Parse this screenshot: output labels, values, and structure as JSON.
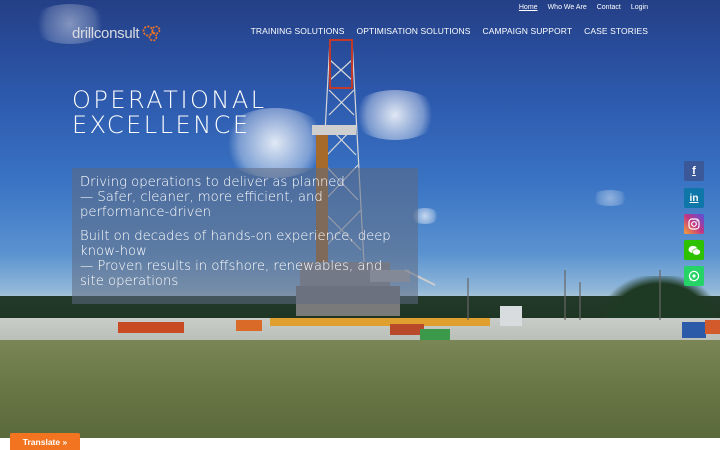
{
  "brand": {
    "logo_text": "drillconsult",
    "accent": "#f27420"
  },
  "top_nav": [
    {
      "label": "Home",
      "active": true
    },
    {
      "label": "Who We Are"
    },
    {
      "label": "Contact"
    },
    {
      "label": "Login"
    }
  ],
  "main_nav": [
    {
      "label": "TRAINING SOLUTIONS"
    },
    {
      "label": "OPTIMISATION SOLUTIONS"
    },
    {
      "label": "CAMPAIGN SUPPORT"
    },
    {
      "label": "CASE STORIES"
    }
  ],
  "hero": {
    "headline_line1": "OPERATIONAL",
    "headline_line2": "EXCELLENCE",
    "panel_lines": [
      "Driving operations to deliver as planned",
      " — Safer, cleaner, more efficient, and performance-driven",
      "Built on decades of hands-on experience, deep know-how",
      " — Proven results in offshore, renewables, and site operations"
    ]
  },
  "social": [
    {
      "name": "facebook-icon",
      "glyph": "f",
      "color": "#3b5998"
    },
    {
      "name": "linkedin-icon",
      "glyph": "in",
      "color": "#0e76a8"
    },
    {
      "name": "instagram-icon",
      "glyph": "◎",
      "color": "#c13584"
    },
    {
      "name": "wechat-icon",
      "glyph": "●●",
      "color": "#2dc100"
    },
    {
      "name": "whatsapp-icon",
      "glyph": "✆",
      "color": "#25d366"
    }
  ],
  "translate": {
    "label": "Translate »"
  }
}
